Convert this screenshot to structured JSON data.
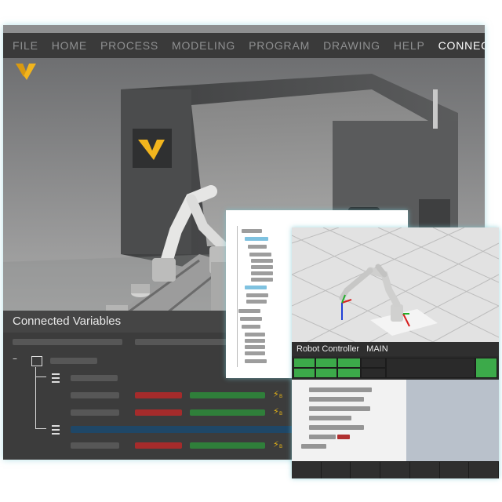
{
  "menu": {
    "items": [
      {
        "label": "FILE"
      },
      {
        "label": "HOME"
      },
      {
        "label": "PROCESS"
      },
      {
        "label": "MODELING"
      },
      {
        "label": "PROGRAM"
      },
      {
        "label": "DRAWING"
      },
      {
        "label": "HELP"
      },
      {
        "label": "CONNECTIVTY",
        "active": true
      }
    ]
  },
  "brand": {
    "logo_icon": "v-logo-icon",
    "color": "#f2b51d"
  },
  "variables_panel": {
    "title": "Connected Variables",
    "icons": {
      "bolt": "⚡",
      "bolt_sub": "B"
    },
    "colors": {
      "red": "#a52b2b",
      "green": "#2f7f3a",
      "blue": "#1f4767"
    }
  },
  "robot_controller": {
    "label": "Robot Controller",
    "program": "MAIN",
    "status_color": "#3caa4a"
  },
  "accent": "#7fc2e0"
}
